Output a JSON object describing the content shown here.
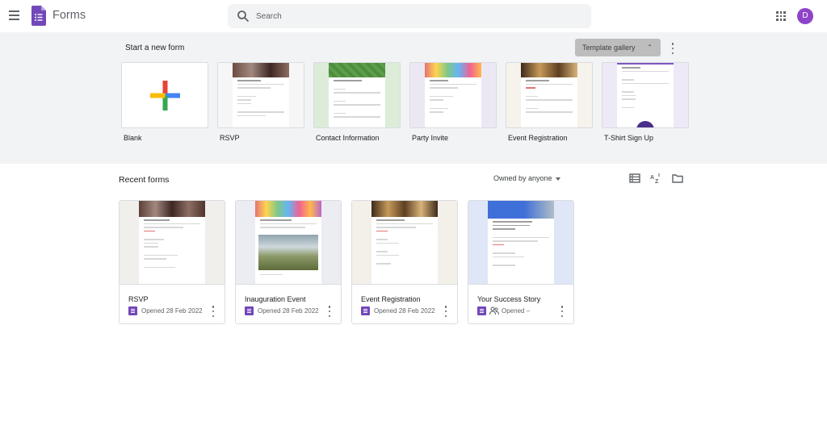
{
  "header": {
    "app_title": "Forms",
    "search_placeholder": "Search",
    "avatar_letter": "D"
  },
  "start": {
    "title": "Start a new form",
    "template_gallery_label": "Template gallery",
    "templates": [
      {
        "label": "Blank"
      },
      {
        "label": "RSVP"
      },
      {
        "label": "Contact Information"
      },
      {
        "label": "Party Invite"
      },
      {
        "label": "Event Registration"
      },
      {
        "label": "T-Shirt Sign Up"
      }
    ]
  },
  "recent": {
    "title": "Recent forms",
    "owner_filter": "Owned by anyone",
    "forms": [
      {
        "title": "RSVP",
        "opened": "Opened 28 Feb 2022"
      },
      {
        "title": "Inauguration Event",
        "opened": "Opened 28 Feb 2022"
      },
      {
        "title": "Event Registration",
        "opened": "Opened 28 Feb 2022"
      },
      {
        "title": "Your Success Story",
        "opened": "Opened –"
      }
    ]
  },
  "colors": {
    "forms_purple": "#7248b9",
    "avatar": "#8e44c8",
    "section_bg": "#f1f3f4"
  }
}
